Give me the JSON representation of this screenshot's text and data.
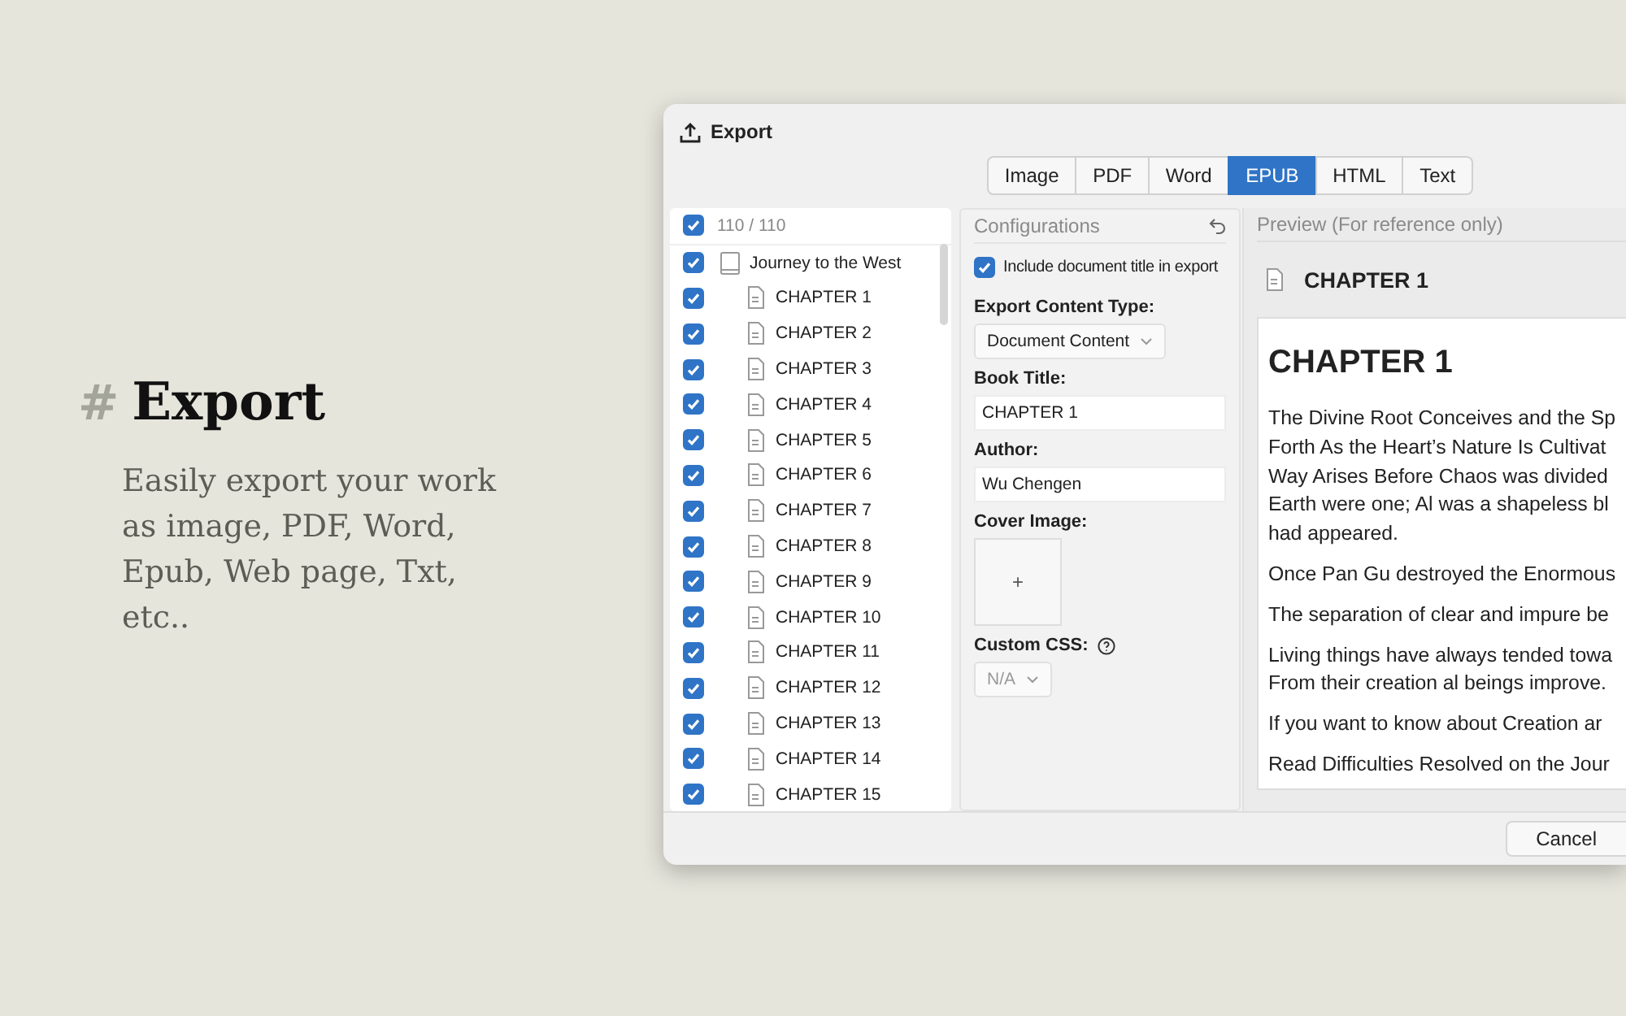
{
  "promo": {
    "mark": "#",
    "title": "Export",
    "text": "Easily export your work as image, PDF, Word, Epub, Web page, Txt, etc.."
  },
  "window": {
    "title": "Export"
  },
  "tabs": [
    {
      "label": "Image",
      "selected": false
    },
    {
      "label": "PDF",
      "selected": false
    },
    {
      "label": "Word",
      "selected": false
    },
    {
      "label": "EPUB",
      "selected": true
    },
    {
      "label": "HTML",
      "selected": false
    },
    {
      "label": "Text",
      "selected": false
    }
  ],
  "tree": {
    "count": "110 / 110",
    "checked": true,
    "items": [
      {
        "label": "Journey to the West",
        "kind": "book",
        "checked": true,
        "children": [
          {
            "label": "CHAPTER 1",
            "kind": "doc",
            "checked": true
          },
          {
            "label": "CHAPTER 2",
            "kind": "doc",
            "checked": true
          },
          {
            "label": "CHAPTER 3",
            "kind": "doc",
            "checked": true
          },
          {
            "label": "CHAPTER 4",
            "kind": "doc",
            "checked": true
          },
          {
            "label": "CHAPTER 5",
            "kind": "doc",
            "checked": true
          },
          {
            "label": "CHAPTER 6",
            "kind": "doc",
            "checked": true
          },
          {
            "label": "CHAPTER 7",
            "kind": "doc",
            "checked": true
          },
          {
            "label": "CHAPTER 8",
            "kind": "doc",
            "checked": true
          },
          {
            "label": "CHAPTER 9",
            "kind": "doc",
            "checked": true
          },
          {
            "label": "CHAPTER 10",
            "kind": "doc",
            "checked": true
          },
          {
            "label": "CHAPTER 11",
            "kind": "doc",
            "checked": true
          },
          {
            "label": "CHAPTER 12",
            "kind": "doc",
            "checked": true
          },
          {
            "label": "CHAPTER 13",
            "kind": "doc",
            "checked": true
          },
          {
            "label": "CHAPTER 14",
            "kind": "doc",
            "checked": true
          },
          {
            "label": "CHAPTER 15",
            "kind": "doc",
            "checked": true
          }
        ]
      }
    ]
  },
  "config": {
    "title": "Configurations",
    "fields": [
      {
        "kind": "checkbox",
        "label": "Include document title in export",
        "checked": true
      },
      {
        "kind": "select",
        "label": "Export Content Type:",
        "value": "Document Content",
        "disabled": false
      },
      {
        "kind": "input",
        "label": "Book Title:",
        "value": "CHAPTER 1"
      },
      {
        "kind": "input",
        "label": "Author:",
        "value": "Wu Chengen"
      },
      {
        "kind": "image",
        "label": "Cover Image:",
        "button": "+"
      },
      {
        "kind": "select",
        "label": "Custom CSS:",
        "value": "N/A",
        "help": true,
        "disabled": true
      }
    ]
  },
  "preview": {
    "title": "Preview (For reference only)",
    "doc_title": "CHAPTER 1",
    "heading": "CHAPTER 1",
    "paragraphs": [
      [
        "The Divine Root Conceives and the Sp",
        "Forth As the Heart’s Nature Is Cultivat",
        "Way Arises Before Chaos was divided",
        "Earth were one; Al was a shapeless bl",
        "had appeared."
      ],
      [
        "Once Pan Gu destroyed the Enormous"
      ],
      [
        "The separation of clear and impure be"
      ],
      [
        "Living things have always tended towa",
        "From their creation al beings improve."
      ],
      [
        "If you want to know about Creation ar"
      ],
      [
        "Read Difficulties Resolved on the Jour"
      ]
    ]
  },
  "buttons": [
    "Cancel"
  ]
}
